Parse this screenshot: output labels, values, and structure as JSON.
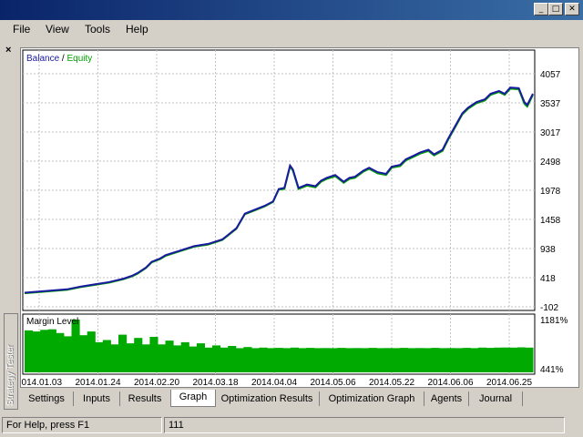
{
  "window": {
    "controls": {
      "minimize": "_",
      "maximize": "□",
      "close": "✕"
    }
  },
  "menu": [
    "File",
    "View",
    "Tools",
    "Help"
  ],
  "panel": {
    "close_glyph": "×",
    "side_label": "Strategy Tester"
  },
  "chart_data": [
    {
      "type": "line",
      "legend": {
        "balance": "Balance",
        "sep": " / ",
        "equity": "Equity"
      },
      "colors": {
        "balance": "#1a1aa0",
        "equity": "#00a000",
        "grid": "#c0c0c0"
      },
      "y_ticks": [
        "4057",
        "3537",
        "3017",
        "2498",
        "1978",
        "1458",
        "938",
        "418",
        "-102"
      ],
      "ylim": [
        -102,
        4057
      ],
      "x_range": [
        0,
        180
      ],
      "grid": true,
      "series": [
        {
          "name": "Balance",
          "x": [
            0,
            5,
            10,
            15,
            20,
            25,
            30,
            35,
            38,
            40,
            43,
            45,
            48,
            50,
            55,
            60,
            65,
            70,
            72,
            75,
            78,
            80,
            85,
            88,
            90,
            92,
            94,
            95,
            97,
            100,
            103,
            105,
            107,
            110,
            113,
            115,
            117,
            120,
            122,
            125,
            128,
            130,
            133,
            135,
            138,
            140,
            143,
            145,
            148,
            150,
            152,
            155,
            157,
            160,
            163,
            165,
            168,
            170,
            172,
            175,
            177,
            178,
            180
          ],
          "y": [
            150,
            170,
            190,
            210,
            260,
            300,
            340,
            400,
            450,
            500,
            600,
            700,
            760,
            820,
            900,
            980,
            1020,
            1100,
            1180,
            1300,
            1560,
            1600,
            1700,
            1780,
            2000,
            2020,
            2420,
            2350,
            2020,
            2080,
            2050,
            2150,
            2200,
            2250,
            2130,
            2200,
            2220,
            2330,
            2380,
            2300,
            2270,
            2400,
            2430,
            2530,
            2600,
            2650,
            2700,
            2620,
            2700,
            2900,
            3080,
            3350,
            3450,
            3550,
            3600,
            3700,
            3750,
            3700,
            3810,
            3800,
            3550,
            3500,
            3700
          ]
        },
        {
          "name": "Equity",
          "x": [
            0,
            5,
            10,
            15,
            20,
            25,
            30,
            35,
            38,
            40,
            43,
            45,
            48,
            50,
            55,
            60,
            65,
            70,
            72,
            75,
            78,
            80,
            85,
            88,
            90,
            92,
            94,
            95,
            97,
            100,
            103,
            105,
            107,
            110,
            113,
            115,
            117,
            120,
            122,
            125,
            128,
            130,
            133,
            135,
            138,
            140,
            143,
            145,
            148,
            150,
            152,
            155,
            157,
            160,
            163,
            165,
            168,
            170,
            172,
            175,
            177,
            178,
            180
          ],
          "y": [
            140,
            160,
            180,
            200,
            250,
            290,
            330,
            390,
            440,
            490,
            590,
            690,
            750,
            810,
            890,
            970,
            1010,
            1090,
            1170,
            1290,
            1550,
            1590,
            1690,
            1770,
            1990,
            2000,
            2400,
            2330,
            2000,
            2060,
            2030,
            2130,
            2180,
            2230,
            2110,
            2180,
            2200,
            2310,
            2360,
            2280,
            2250,
            2380,
            2410,
            2510,
            2580,
            2630,
            2680,
            2600,
            2680,
            2880,
            3060,
            3330,
            3430,
            3530,
            3580,
            3680,
            3730,
            3680,
            3790,
            3780,
            3520,
            3470,
            3680
          ]
        }
      ]
    },
    {
      "type": "bar",
      "title": "Margin Level",
      "colors": {
        "bars": "#00aa00"
      },
      "y_ticks": [
        "1181%",
        "441%"
      ],
      "ylim": [
        441,
        1181
      ],
      "values": [
        980,
        960,
        990,
        1000,
        930,
        870,
        1181,
        890,
        960,
        760,
        800,
        720,
        900,
        740,
        840,
        720,
        860,
        720,
        790,
        700,
        760,
        680,
        740,
        660,
        700,
        660,
        690,
        650,
        670,
        650,
        660,
        650,
        655,
        650,
        660,
        650,
        655,
        650,
        652,
        650,
        655,
        650,
        652,
        650,
        655,
        650,
        652,
        650,
        655,
        650,
        652,
        650,
        655,
        650,
        652,
        650,
        655,
        650,
        660,
        655,
        660,
        662,
        660,
        665,
        660
      ]
    }
  ],
  "x_labels": [
    "2014.01.03",
    "2014.01.24",
    "2014.02.20",
    "2014.03.18",
    "2014.04.04",
    "2014.05.06",
    "2014.05.22",
    "2014.06.06",
    "2014.06.25"
  ],
  "tabs": [
    "Settings",
    "Inputs",
    "Results",
    "Graph",
    "Optimization Results",
    "Optimization Graph",
    "Agents",
    "Journal"
  ],
  "active_tab": "Graph",
  "status": {
    "help": "For Help, press F1",
    "value": "111"
  }
}
